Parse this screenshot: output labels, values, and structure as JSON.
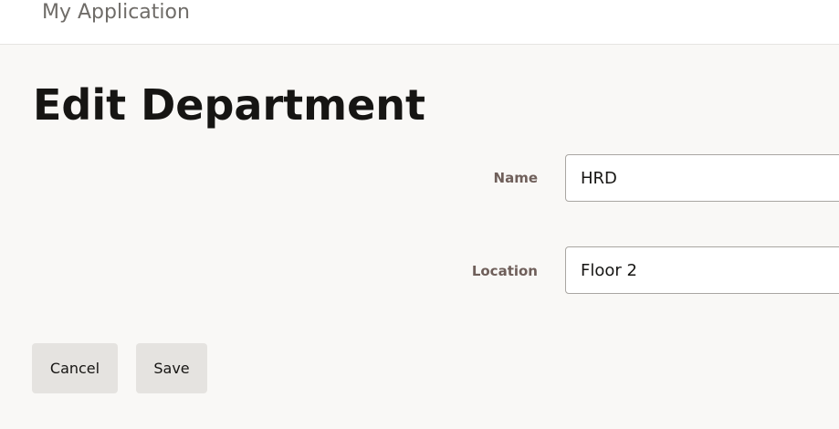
{
  "header": {
    "title": "My Application"
  },
  "page": {
    "title": "Edit Department"
  },
  "form": {
    "name_label": "Name",
    "name_value": "HRD",
    "location_label": "Location",
    "location_value": "Floor 2"
  },
  "actions": {
    "cancel": "Cancel",
    "save": "Save"
  }
}
